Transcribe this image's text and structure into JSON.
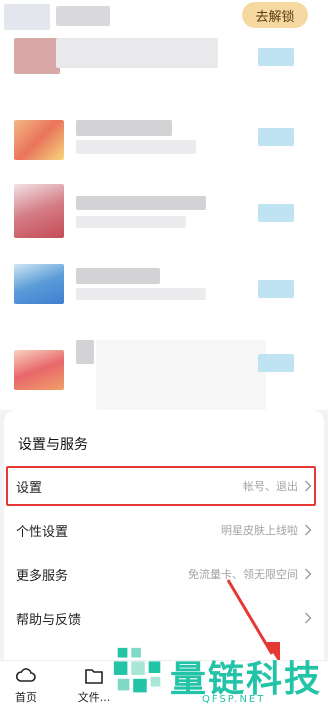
{
  "top": {
    "unlock_label": "去解锁"
  },
  "settings": {
    "title": "设置与服务",
    "rows": [
      {
        "label": "设置",
        "desc": "帐号、退出"
      },
      {
        "label": "个性设置",
        "desc": "明星皮肤上线啦"
      },
      {
        "label": "更多服务",
        "desc": "免流量卡、领无限空间"
      },
      {
        "label": "帮助与反馈",
        "desc": ""
      }
    ]
  },
  "nav": {
    "items": [
      {
        "label": "首页",
        "icon": "cloud-icon"
      },
      {
        "label": "文件...",
        "icon": "folder-icon"
      }
    ]
  },
  "watermark": {
    "title": "量链科技",
    "subtitle": "QFSP.NET"
  },
  "colors": {
    "highlight": "#e53935",
    "unlock_bg": "#f6d9a0",
    "watermark": "#22c3a6"
  }
}
